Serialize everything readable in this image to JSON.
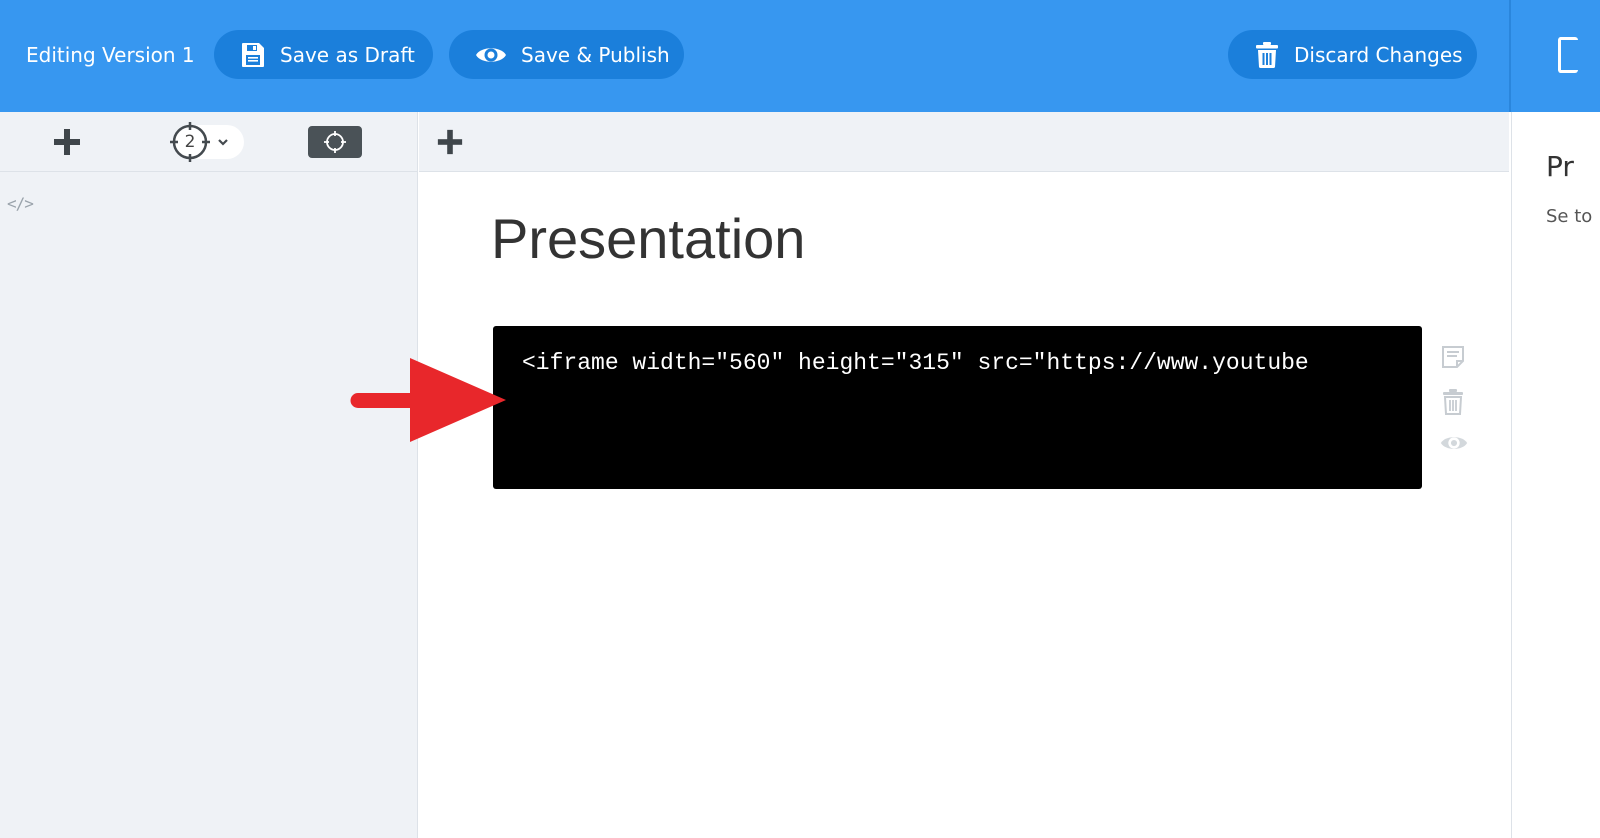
{
  "topbar": {
    "version_label": "Editing Version 1",
    "save_draft_label": "Save as Draft",
    "save_publish_label": "Save & Publish",
    "discard_label": "Discard Changes"
  },
  "sidebar": {
    "target_count": "2",
    "code_tag": "</>"
  },
  "main": {
    "title": "Presentation",
    "code_block_text": "<iframe width=\"560\" height=\"315\" src=\"https://www.youtube"
  },
  "right_panel": {
    "title": "Pr",
    "description": "Se to"
  },
  "icons": {
    "save_draft": "floppy-disk-icon",
    "save_publish": "eye-icon",
    "discard": "trash-icon",
    "add": "plus-icon",
    "target": "crosshair-icon",
    "block_note": "note-icon",
    "block_delete": "trash-icon",
    "block_preview": "eye-icon",
    "annotation": "red-arrow-icon"
  },
  "colors": {
    "topbar": "#3797f0",
    "pill": "#1b7fdb",
    "code_background": "#000000",
    "annotation_arrow": "#e8272b"
  }
}
